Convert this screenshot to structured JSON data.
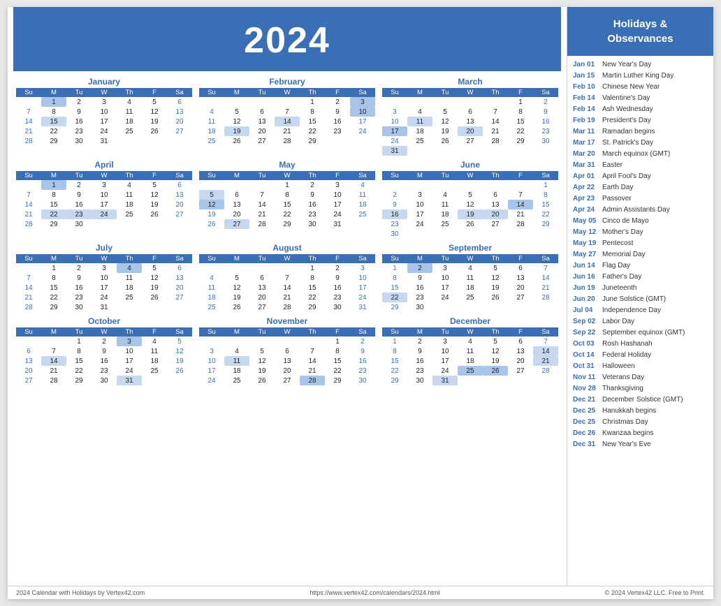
{
  "header": {
    "year": "2024",
    "bg_color": "#3a6eb5"
  },
  "sidebar": {
    "title": "Holidays &\nObservances"
  },
  "months": [
    {
      "name": "January",
      "weeks": [
        [
          "",
          "1",
          "2",
          "3",
          "4",
          "5",
          "6"
        ],
        [
          "7",
          "8",
          "9",
          "10",
          "11",
          "12",
          "13"
        ],
        [
          "14",
          "15",
          "16",
          "17",
          "18",
          "19",
          "20"
        ],
        [
          "21",
          "22",
          "23",
          "24",
          "25",
          "26",
          "27"
        ],
        [
          "28",
          "29",
          "30",
          "31",
          "",
          "",
          ""
        ]
      ],
      "highlights": {
        "1-1": "blue",
        "1-15": "circle"
      }
    },
    {
      "name": "February",
      "weeks": [
        [
          "",
          "",
          "",
          "",
          "1",
          "2",
          "3"
        ],
        [
          "4",
          "5",
          "6",
          "7",
          "8",
          "9",
          "10"
        ],
        [
          "11",
          "12",
          "13",
          "14",
          "15",
          "16",
          "17"
        ],
        [
          "18",
          "19",
          "20",
          "21",
          "22",
          "23",
          "24"
        ],
        [
          "25",
          "26",
          "27",
          "28",
          "29",
          "",
          ""
        ]
      ],
      "highlights": {
        "2-3": "blue",
        "2-10": "blue",
        "2-14": "circle",
        "2-19": "circle"
      }
    },
    {
      "name": "March",
      "weeks": [
        [
          "",
          "",
          "",
          "",
          "",
          "1",
          "2"
        ],
        [
          "3",
          "4",
          "5",
          "6",
          "7",
          "8",
          "9"
        ],
        [
          "10",
          "11",
          "12",
          "13",
          "14",
          "15",
          "16"
        ],
        [
          "17",
          "18",
          "19",
          "20",
          "21",
          "22",
          "23"
        ],
        [
          "24",
          "25",
          "26",
          "27",
          "28",
          "29",
          "30"
        ],
        [
          "31",
          "",
          "",
          "",
          "",
          "",
          ""
        ]
      ],
      "highlights": {
        "3-11": "circle",
        "3-17": "blue",
        "3-20": "circle",
        "3-31": "light"
      }
    },
    {
      "name": "April",
      "weeks": [
        [
          "",
          "1",
          "2",
          "3",
          "4",
          "5",
          "6"
        ],
        [
          "7",
          "8",
          "9",
          "10",
          "11",
          "12",
          "13"
        ],
        [
          "14",
          "15",
          "16",
          "17",
          "18",
          "19",
          "20"
        ],
        [
          "21",
          "22",
          "23",
          "24",
          "25",
          "26",
          "27"
        ],
        [
          "28",
          "29",
          "30",
          "",
          "",
          "",
          ""
        ]
      ],
      "highlights": {
        "4-1": "blue",
        "4-22": "circle",
        "4-23": "circle",
        "4-24": "circle"
      }
    },
    {
      "name": "May",
      "weeks": [
        [
          "",
          "",
          "",
          "1",
          "2",
          "3",
          "4"
        ],
        [
          "5",
          "6",
          "7",
          "8",
          "9",
          "10",
          "11"
        ],
        [
          "12",
          "13",
          "14",
          "15",
          "16",
          "17",
          "18"
        ],
        [
          "19",
          "20",
          "21",
          "22",
          "23",
          "24",
          "25"
        ],
        [
          "26",
          "27",
          "28",
          "29",
          "30",
          "31",
          ""
        ]
      ],
      "highlights": {
        "5-5": "circle",
        "5-12": "blue",
        "5-27": "circle"
      }
    },
    {
      "name": "June",
      "weeks": [
        [
          "",
          "",
          "",
          "",
          "",
          "",
          "1"
        ],
        [
          "2",
          "3",
          "4",
          "5",
          "6",
          "7",
          "8"
        ],
        [
          "9",
          "10",
          "11",
          "12",
          "13",
          "14",
          "15"
        ],
        [
          "16",
          "17",
          "18",
          "19",
          "20",
          "21",
          "22"
        ],
        [
          "23",
          "24",
          "25",
          "26",
          "27",
          "28",
          "29"
        ],
        [
          "30",
          "",
          "",
          "",
          "",
          "",
          ""
        ]
      ],
      "highlights": {
        "6-14": "blue",
        "6-16": "circle",
        "6-19": "circle",
        "6-20": "circle"
      }
    },
    {
      "name": "July",
      "weeks": [
        [
          "",
          "1",
          "2",
          "3",
          "4",
          "5",
          "6"
        ],
        [
          "7",
          "8",
          "9",
          "10",
          "11",
          "12",
          "13"
        ],
        [
          "14",
          "15",
          "16",
          "17",
          "18",
          "19",
          "20"
        ],
        [
          "21",
          "22",
          "23",
          "24",
          "25",
          "26",
          "27"
        ],
        [
          "28",
          "29",
          "30",
          "31",
          "",
          "",
          ""
        ]
      ],
      "highlights": {
        "7-4": "blue"
      }
    },
    {
      "name": "August",
      "weeks": [
        [
          "",
          "",
          "",
          "",
          "1",
          "2",
          "3"
        ],
        [
          "4",
          "5",
          "6",
          "7",
          "8",
          "9",
          "10"
        ],
        [
          "11",
          "12",
          "13",
          "14",
          "15",
          "16",
          "17"
        ],
        [
          "18",
          "19",
          "20",
          "21",
          "22",
          "23",
          "24"
        ],
        [
          "25",
          "26",
          "27",
          "28",
          "29",
          "30",
          "31"
        ]
      ],
      "highlights": {}
    },
    {
      "name": "September",
      "weeks": [
        [
          "1",
          "2",
          "3",
          "4",
          "5",
          "6",
          "7"
        ],
        [
          "8",
          "9",
          "10",
          "11",
          "12",
          "13",
          "14"
        ],
        [
          "15",
          "16",
          "17",
          "18",
          "19",
          "20",
          "21"
        ],
        [
          "22",
          "23",
          "24",
          "25",
          "26",
          "27",
          "28"
        ],
        [
          "29",
          "30",
          "",
          "",
          "",
          "",
          ""
        ]
      ],
      "highlights": {
        "9-2": "blue",
        "9-22": "circle"
      }
    },
    {
      "name": "October",
      "weeks": [
        [
          "",
          "",
          "1",
          "2",
          "3",
          "4",
          "5"
        ],
        [
          "6",
          "7",
          "8",
          "9",
          "10",
          "11",
          "12"
        ],
        [
          "13",
          "14",
          "15",
          "16",
          "17",
          "18",
          "19"
        ],
        [
          "20",
          "21",
          "22",
          "23",
          "24",
          "25",
          "26"
        ],
        [
          "27",
          "28",
          "29",
          "30",
          "31",
          "",
          ""
        ]
      ],
      "highlights": {
        "10-3": "blue",
        "10-14": "circle",
        "10-31": "circle"
      }
    },
    {
      "name": "November",
      "weeks": [
        [
          "",
          "",
          "",
          "",
          "",
          "1",
          "2"
        ],
        [
          "3",
          "4",
          "5",
          "6",
          "7",
          "8",
          "9"
        ],
        [
          "10",
          "11",
          "12",
          "13",
          "14",
          "15",
          "16"
        ],
        [
          "17",
          "18",
          "19",
          "20",
          "21",
          "22",
          "23"
        ],
        [
          "24",
          "25",
          "26",
          "27",
          "28",
          "29",
          "30"
        ]
      ],
      "highlights": {
        "11-11": "circle",
        "11-28": "blue"
      }
    },
    {
      "name": "December",
      "weeks": [
        [
          "1",
          "2",
          "3",
          "4",
          "5",
          "6",
          "7"
        ],
        [
          "8",
          "9",
          "10",
          "11",
          "12",
          "13",
          "14"
        ],
        [
          "15",
          "16",
          "17",
          "18",
          "19",
          "20",
          "21"
        ],
        [
          "22",
          "23",
          "24",
          "25",
          "26",
          "27",
          "28"
        ],
        [
          "29",
          "30",
          "31",
          "",
          "",
          "",
          ""
        ]
      ],
      "highlights": {
        "12-14": "circle",
        "12-21": "circle",
        "12-25": "blue",
        "12-26": "blue",
        "12-31": "circle"
      }
    }
  ],
  "holidays": [
    {
      "date": "Jan 01",
      "name": "New Year's Day"
    },
    {
      "date": "Jan 15",
      "name": "Martin Luther King Day"
    },
    {
      "date": "Feb 10",
      "name": "Chinese New Year"
    },
    {
      "date": "Feb 14",
      "name": "Valentine's Day"
    },
    {
      "date": "Feb 14",
      "name": "Ash Wednesday"
    },
    {
      "date": "Feb 19",
      "name": "President's Day"
    },
    {
      "date": "Mar 11",
      "name": "Ramadan begins"
    },
    {
      "date": "Mar 17",
      "name": "St. Patrick's Day"
    },
    {
      "date": "Mar 20",
      "name": "March equinox (GMT)"
    },
    {
      "date": "Mar 31",
      "name": "Easter"
    },
    {
      "date": "Apr 01",
      "name": "April Fool's Day"
    },
    {
      "date": "Apr 22",
      "name": "Earth Day"
    },
    {
      "date": "Apr 23",
      "name": "Passover"
    },
    {
      "date": "Apr 24",
      "name": "Admin Assistants Day"
    },
    {
      "date": "May 05",
      "name": "Cinco de Mayo"
    },
    {
      "date": "May 12",
      "name": "Mother's Day"
    },
    {
      "date": "May 19",
      "name": "Pentecost"
    },
    {
      "date": "May 27",
      "name": "Memorial Day"
    },
    {
      "date": "Jun 14",
      "name": "Flag Day"
    },
    {
      "date": "Jun 16",
      "name": "Father's Day"
    },
    {
      "date": "Jun 19",
      "name": "Juneteenth"
    },
    {
      "date": "Jun 20",
      "name": "June Solstice (GMT)"
    },
    {
      "date": "Jul 04",
      "name": "Independence Day"
    },
    {
      "date": "Sep 02",
      "name": "Labor Day"
    },
    {
      "date": "Sep 22",
      "name": "September equinox (GMT)"
    },
    {
      "date": "Oct 03",
      "name": "Rosh Hashanah"
    },
    {
      "date": "Oct 14",
      "name": "Federal Holiday"
    },
    {
      "date": "Oct 31",
      "name": "Halloween"
    },
    {
      "date": "Nov 11",
      "name": "Veterans Day"
    },
    {
      "date": "Nov 28",
      "name": "Thanksgiving"
    },
    {
      "date": "Dec 21",
      "name": "December Solstice (GMT)"
    },
    {
      "date": "Dec 25",
      "name": "Hanukkah begins"
    },
    {
      "date": "Dec 25",
      "name": "Christmas Day"
    },
    {
      "date": "Dec 26",
      "name": "Kwanzaa begins"
    },
    {
      "date": "Dec 31",
      "name": "New Year's Eve"
    }
  ],
  "footer": {
    "left": "2024 Calendar with Holidays by Vertex42.com",
    "center": "https://www.vertex42.com/calendars/2024.html",
    "right": "© 2024 Vertex42 LLC. Free to Print."
  },
  "days_header": [
    "Su",
    "M",
    "Tu",
    "W",
    "Th",
    "F",
    "Sa"
  ]
}
